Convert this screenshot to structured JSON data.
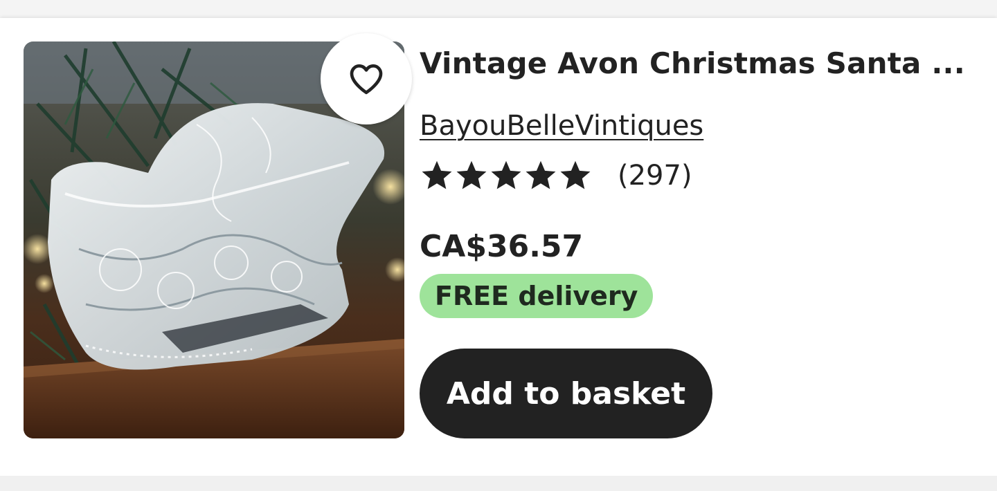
{
  "listing": {
    "title": "Vintage Avon Christmas Santa ...",
    "shop_name": "BayouBelleVintiques",
    "rating_stars": 5,
    "review_count": "(297)",
    "price": "CA$36.57",
    "badge": "FREE delivery",
    "add_to_basket_label": "Add to basket",
    "favorite_icon": "heart-outline-icon",
    "star_icon": "star-filled-icon"
  },
  "colors": {
    "badge_bg": "#9ee39a",
    "button_bg": "#222222",
    "button_text": "#ffffff",
    "text": "#222222"
  }
}
